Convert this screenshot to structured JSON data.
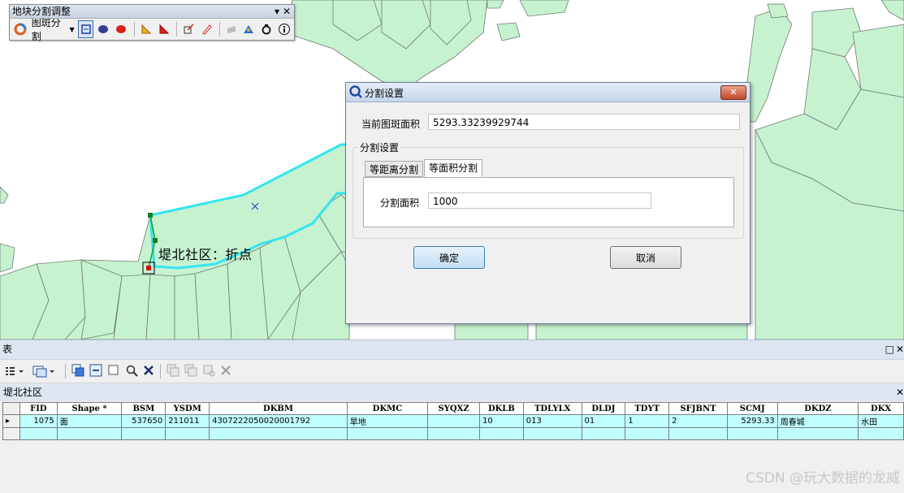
{
  "toolbar": {
    "title": "地块分割调整",
    "split_label": "图斑分割",
    "menu_glyph": "▾",
    "close_glyph": "✕"
  },
  "map": {
    "label": "堤北社区：折点",
    "fill_color": "#c6f2d0",
    "highlight_color": "#33e5ee"
  },
  "dialog": {
    "title": "分割设置",
    "close_glyph": "✕",
    "area_label": "当前图斑面积",
    "area_value": "5293.33239929744",
    "group_title": "分割设置",
    "tabs": [
      {
        "label": "等距离分割",
        "selected": false
      },
      {
        "label": "等面积分割",
        "selected": true
      }
    ],
    "split_area_label": "分割面积",
    "split_area_value": "1000",
    "ok_label": "确定",
    "cancel_label": "取消"
  },
  "table_window": {
    "title": "表",
    "restore_glyph": "□",
    "close_glyph": "✕",
    "layer_tab": "堤北社区",
    "tab_close": "✕",
    "columns": [
      "FID",
      "Shape *",
      "BSM",
      "YSDM",
      "DKBM",
      "DKMC",
      "SYQXZ",
      "DKLB",
      "TDLYLX",
      "DLDJ",
      "TDYT",
      "SFJBNT",
      "SCMJ",
      "DKDZ",
      "DKX"
    ],
    "rows": [
      {
        "marker": "▸",
        "cells": [
          "1075",
          "面",
          "537650",
          "211011",
          "430722205002000179​2",
          "旱地",
          "",
          "10",
          "013",
          "01",
          "1",
          "2",
          "5293.33",
          "周春城",
          "水田"
        ]
      }
    ]
  },
  "watermark": "CSDN @玩大数据的龙威"
}
